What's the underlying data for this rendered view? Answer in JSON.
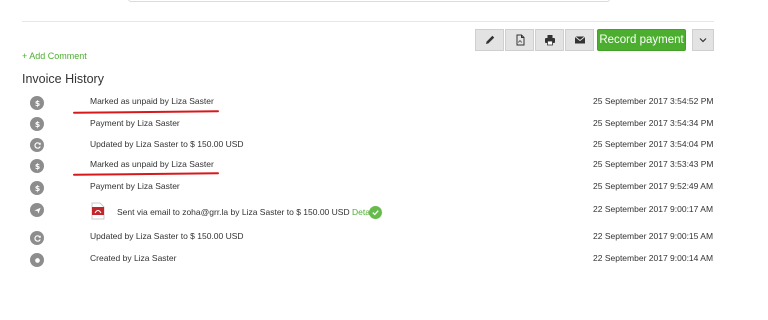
{
  "colors": {
    "accent": "#4cae2f",
    "annotation": "#d7191c",
    "icon": "#8d8d8d"
  },
  "toolbar": {
    "icons": [
      "pencil-icon",
      "pdf-icon",
      "print-icon",
      "email-icon"
    ],
    "record_label": "Record payment"
  },
  "add_comment": "+ Add Comment",
  "history_title": "Invoice History",
  "history": [
    {
      "icon": "dollar-icon",
      "text": "Marked as unpaid by Liza Saster",
      "date": "25 September 2017 3:54:52 PM",
      "highlighted": true
    },
    {
      "icon": "dollar-icon",
      "text": "Payment by Liza Saster",
      "date": "25 September 2017 3:54:34 PM",
      "highlighted": false
    },
    {
      "icon": "refresh-icon",
      "text": "Updated by Liza Saster to $ 150.00 USD",
      "date": "25 September 2017 3:54:04 PM",
      "highlighted": false
    },
    {
      "icon": "dollar-icon",
      "text": "Marked as unpaid by Liza Saster",
      "date": "25 September 2017 3:53:43 PM",
      "highlighted": true
    },
    {
      "icon": "dollar-icon",
      "text": "Payment by Liza Saster",
      "date": "25 September 2017 9:52:49 AM",
      "highlighted": false
    },
    {
      "icon": "send-icon",
      "text": "Sent via email to zoha@grr.la by Liza Saster to $ 150.00 USD",
      "link": "Details",
      "date": "22 September 2017 9:00:17 AM",
      "highlighted": false
    },
    {
      "icon": "refresh-icon",
      "text": "Updated by Liza Saster to $ 150.00 USD",
      "date": "22 September 2017 9:00:15 AM",
      "highlighted": false
    },
    {
      "icon": "circle-icon",
      "text": "Created by Liza Saster",
      "date": "22 September 2017 9:00:14 AM",
      "highlighted": false
    }
  ]
}
